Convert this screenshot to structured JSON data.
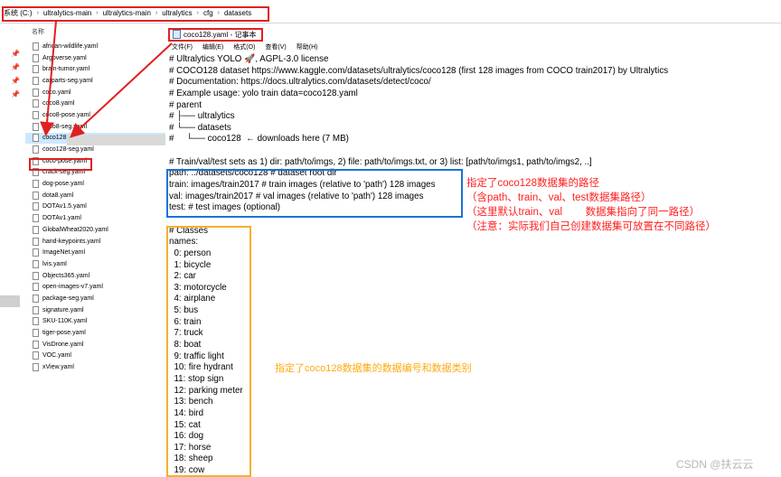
{
  "address_bar": {
    "crumbs": [
      "系统 (C:)",
      "ultralytics-main",
      "ultralytics-main",
      "ultralytics",
      "cfg",
      "datasets"
    ],
    "separator": "›"
  },
  "file_list": {
    "column_header": "名称",
    "files": [
      "african-wildlife.yaml",
      "Argoverse.yaml",
      "brain-tumor.yaml",
      "carparts-seg.yaml",
      "coco.yaml",
      "coco8.yaml",
      "coco8-pose.yaml",
      "coco8-seg.yaml",
      "coco128.yaml",
      "coco128-seg.yaml",
      "coco-pose.yaml",
      "crack-seg.yaml",
      "dog-pose.yaml",
      "dota8.yaml",
      "DOTAv1.5.yaml",
      "DOTAv1.yaml",
      "GlobalWheat2020.yaml",
      "hand-keypoints.yaml",
      "ImageNet.yaml",
      "lvis.yaml",
      "Objects365.yaml",
      "open-images-v7.yaml",
      "package-seg.yaml",
      "signature.yaml",
      "SKU-110K.yaml",
      "tiger-pose.yaml",
      "VisDrone.yaml",
      "VOC.yaml",
      "xView.yaml"
    ],
    "selected": "coco128.yaml"
  },
  "notepad": {
    "title": "coco128.yaml - 记事本",
    "menu": [
      "文件(F)",
      "编辑(E)",
      "格式(O)",
      "查看(V)",
      "帮助(H)"
    ],
    "lines": [
      "# Ultralytics YOLO 🚀, AGPL-3.0 license",
      "# COCO128 dataset https://www.kaggle.com/datasets/ultralytics/coco128 (first 128 images from COCO train2017) by Ultralytics",
      "# Documentation: https://docs.ultralytics.com/datasets/detect/coco/",
      "# Example usage: yolo train data=coco128.yaml",
      "# parent",
      "# ├── ultralytics",
      "# └── datasets",
      "#     └── coco128  ← downloads here (7 MB)",
      "",
      "# Train/val/test sets as 1) dir: path/to/imgs, 2) file: path/to/imgs.txt, or 3) list: [path/to/imgs1, path/to/imgs2, ..]",
      "path: ../datasets/coco128 # dataset root dir",
      "train: images/train2017 # train images (relative to 'path') 128 images",
      "val: images/train2017 # val images (relative to 'path') 128 images",
      "test: # test images (optional)",
      "",
      "# Classes",
      "names:",
      "  0: person",
      "  1: bicycle",
      "  2: car",
      "  3: motorcycle",
      "  4: airplane",
      "  5: bus",
      "  6: train",
      "  7: truck",
      "  8: boat",
      "  9: traffic light",
      "  10: fire hydrant",
      "  11: stop sign",
      "  12: parking meter",
      "  13: bench",
      "  14: bird",
      "  15: cat",
      "  16: dog",
      "  17: horse",
      "  18: sheep",
      "  19: cow"
    ]
  },
  "annotations": {
    "red_note": "指定了coco128数据集的路径\n（含path、train、val、test数据集路径）\n（这里默认train、val        数据集指向了同一路径）\n（注意：实际我们自己创建数据集可放置在不同路径）",
    "orange_note": "指定了coco128数据集的数据编号和数据类别",
    "watermark": "CSDN @扶云云",
    "colors": {
      "red": "#e02020",
      "blue": "#1a73d9",
      "orange": "#f6b030"
    }
  }
}
